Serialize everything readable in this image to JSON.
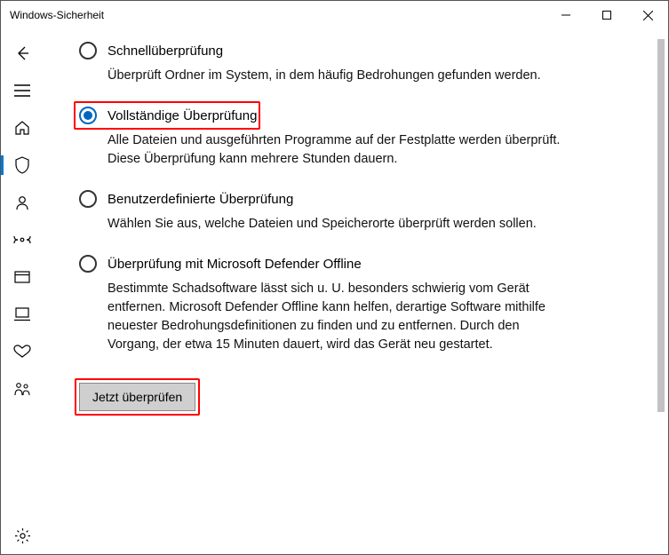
{
  "window": {
    "title": "Windows-Sicherheit"
  },
  "options": {
    "quick": {
      "title": "Schnellüberprüfung",
      "desc": "Überprüft Ordner im System, in dem häufig Bedrohungen gefunden werden."
    },
    "full": {
      "title": "Vollständige Überprüfung",
      "desc": "Alle Dateien und ausgeführten Programme auf der Festplatte werden überprüft. Diese Überprüfung kann mehrere Stunden dauern."
    },
    "custom": {
      "title": "Benutzerdefinierte Überprüfung",
      "desc": "Wählen Sie aus, welche Dateien und Speicherorte überprüft werden sollen."
    },
    "offline": {
      "title": "Überprüfung mit Microsoft Defender Offline",
      "desc": "Bestimmte Schadsoftware lässt sich u. U. besonders schwierig vom Gerät entfernen. Microsoft Defender Offline kann helfen, derartige Software mithilfe neuester Bedrohungsdefinitionen zu finden und zu entfernen. Durch den Vorgang, der etwa 15 Minuten dauert, wird das Gerät neu gestartet."
    }
  },
  "action": {
    "scan_now": "Jetzt überprüfen"
  }
}
